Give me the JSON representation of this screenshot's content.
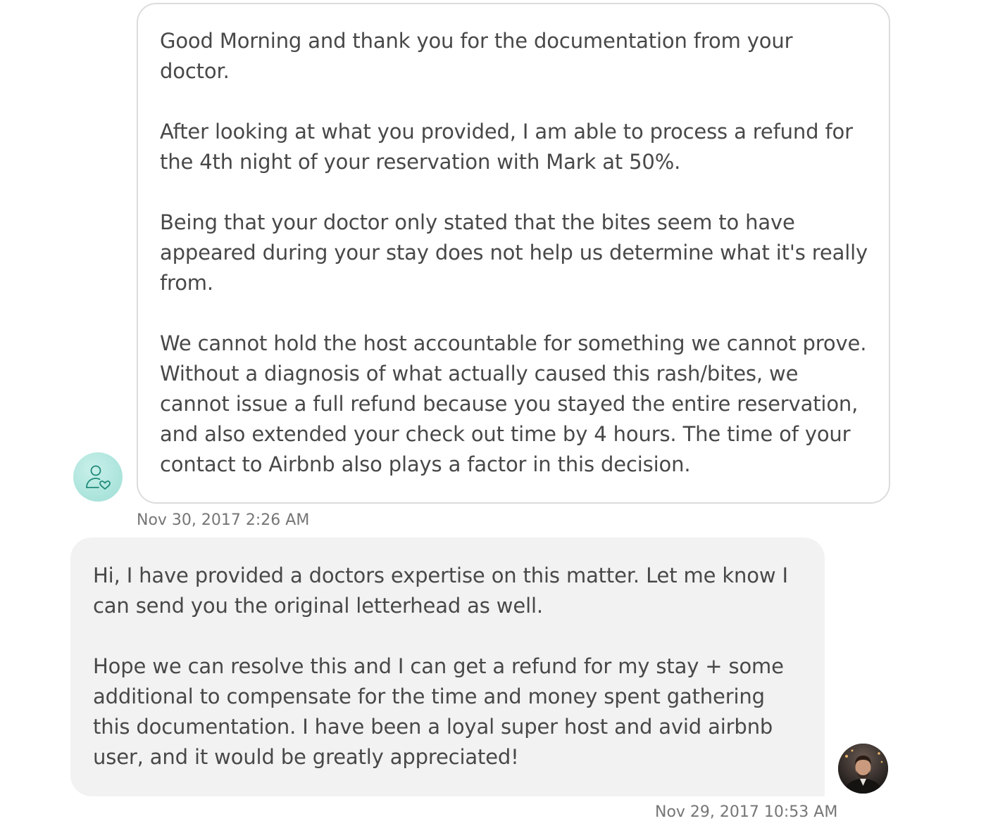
{
  "thread": {
    "support_message": {
      "paragraphs": [
        "Good Morning and thank you for the documentation from your\ndoctor.",
        "After looking at what you provided, I am able to process a refund for\nthe 4th night of your reservation with Mark at 50%.",
        "Being that your doctor only stated that the bites seem to have\nappeared during your stay does not help us determine what it's really\nfrom.",
        "We cannot hold the host accountable for something we cannot prove.\nWithout a diagnosis of what actually caused this rash/bites, we\ncannot issue a full refund because you stayed the entire reservation,\nand also extended your check out time by 4 hours. The time of your\ncontact to Airbnb also plays a factor in this decision."
      ],
      "timestamp": "Nov 30, 2017 2:26 AM",
      "avatar_icon": "support-person-heart-icon"
    },
    "user_message": {
      "paragraphs": [
        "Hi, I have provided a doctors expertise on this matter. Let me know I\ncan send you the original letterhead as well.",
        "Hope we can resolve this and I can get a refund for my stay + some\nadditional to compensate for the time and money spent gathering\nthis documentation. I have been a loyal super host and avid airbnb\nuser, and it would be greatly appreciated!"
      ],
      "timestamp": "Nov 29, 2017 10:53 AM",
      "avatar_icon": "user-avatar-photo"
    }
  },
  "colors": {
    "text": "#484848",
    "timestamp": "#767676",
    "incoming_border": "#dcdcdc",
    "outgoing_bg": "#f2f2f2",
    "support_avatar_bg": "#aee5dd",
    "support_icon_stroke": "#1f8a7a"
  }
}
